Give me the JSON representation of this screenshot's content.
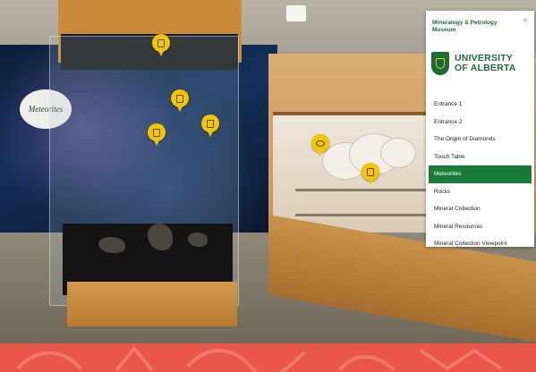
{
  "sign": {
    "text": "Meteorites"
  },
  "menu": {
    "title": "Mineralogy & Petrology Museum",
    "close_icon": "×",
    "logo": {
      "line1": "UNIVERSITY",
      "line2": "OF ALBERTA"
    },
    "items": [
      {
        "label": "Entrance 1",
        "active": false
      },
      {
        "label": "Entrance 2",
        "active": false
      },
      {
        "label": "The Origin of Diamonds",
        "active": false
      },
      {
        "label": "Touch Table",
        "active": false
      },
      {
        "label": "Meteorites",
        "active": true
      },
      {
        "label": "Rocks",
        "active": false
      },
      {
        "label": "Mineral Collection",
        "active": false
      },
      {
        "label": "Mineral Resources",
        "active": false
      },
      {
        "label": "Mineral Collection Viewpoint",
        "active": false
      }
    ]
  },
  "hotspots": [
    {
      "icon": "info-panel-icon"
    },
    {
      "icon": "info-panel-icon"
    },
    {
      "icon": "info-panel-icon"
    },
    {
      "icon": "info-panel-icon"
    },
    {
      "icon": "info-panel-icon"
    },
    {
      "icon": "chat-bubble-icon"
    }
  ],
  "colors": {
    "accent_green": "#1a7a3a",
    "hotspot_yellow": "#f5c400",
    "banner_red": "#e8574a"
  }
}
